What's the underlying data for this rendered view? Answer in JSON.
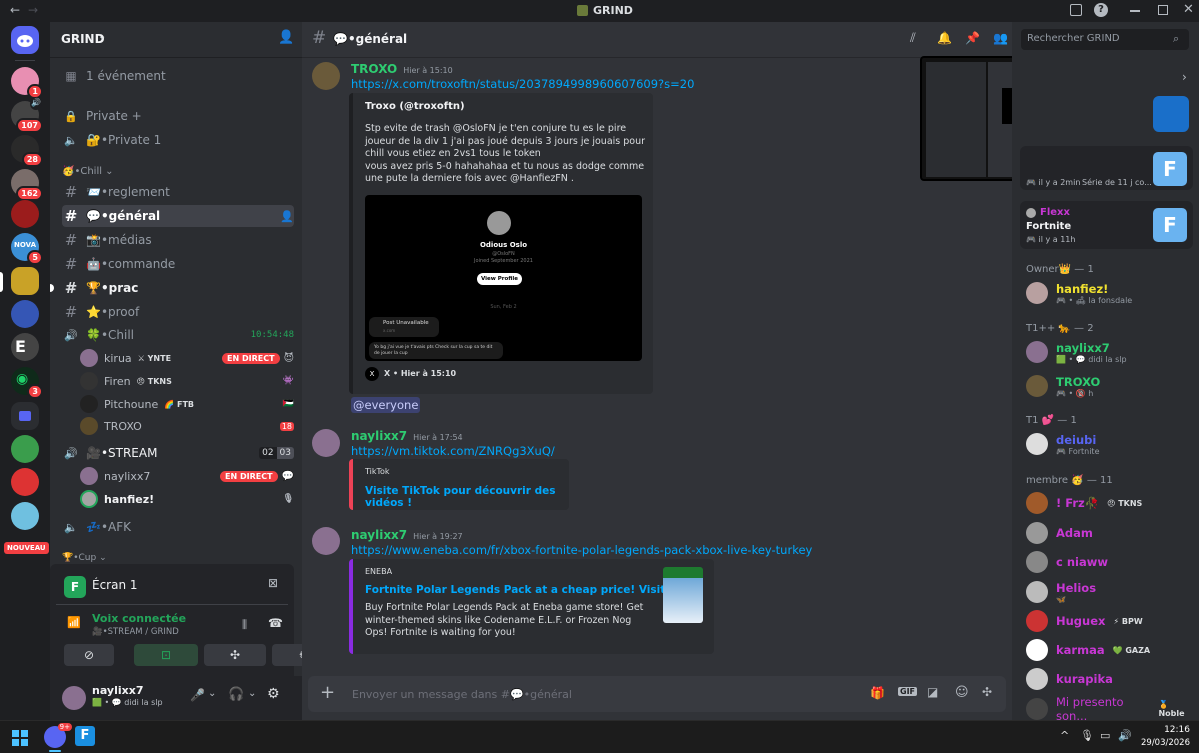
{
  "window": {
    "title": "GRIND"
  },
  "server": {
    "name": "GRIND",
    "event": "1 événement"
  },
  "channels": {
    "private_plus": "Private +",
    "private_1": "🔐•Private 1",
    "cat_chill": "🥳•Chill ⌄",
    "reglement": "📨•reglement",
    "general": "💬•général",
    "medias": "📸•médias",
    "commande": "🤖•commande",
    "prac": "🏆•prac",
    "proof": "⭐•proof",
    "voice_chill": "🍀•Chill",
    "voice_chill_time": "10:54:48",
    "voice_users": [
      {
        "name": "kirua",
        "tag": "⚔ YNTE",
        "live": "EN DIRECT"
      },
      {
        "name": "Firen",
        "tag": "😠 TKNS"
      },
      {
        "name": "Pitchoune",
        "tag": "🌈 FTB"
      },
      {
        "name": "TROXO"
      }
    ],
    "stream": "🎥•STREAM",
    "stream_count_a": "02",
    "stream_count_b": "03",
    "stream_users": [
      {
        "name": "naylixx7",
        "live": "EN DIRECT"
      },
      {
        "name": "hanfiez!"
      }
    ],
    "afk": "💤•AFK",
    "cat_cup": "🏆•Cup ⌄",
    "new_badge": "NOUVEAU"
  },
  "screen": {
    "title": "Écran 1"
  },
  "voice_panel": {
    "status": "Voix connectée",
    "location": "🎥•STREAM / GRIND"
  },
  "user_panel": {
    "name": "naylixx7",
    "status": "🟩 • 💬 didi la slp"
  },
  "header": {
    "channel": "💬•général",
    "search_placeholder": "Rechercher GRIND"
  },
  "messages": [
    {
      "author": "TROXO",
      "time": "Hier à 15:10",
      "link": "https://x.com/troxoftn/status/2037894998960607609?s=20",
      "embed": {
        "author": "Troxo (@troxoftn)",
        "text": "Stp evite de trash @OsloFN je t'en conjure tu es le pire joueur de la div 1 j'ai pas joué depuis 3 jours je jouais pour chill vous etiez en 2vs1 tous le token\nvous avez pris 5-0 hahahahaa et tu nous as dodge comme une pute la derniere fois avec @HanfiezFN .",
        "image": {
          "name": "Odious Oslo",
          "handle": "@OsloFN",
          "joined": "Joined September 2021",
          "button": "View Profile",
          "date": "Sun, Feb 2",
          "unavail": "Post Unavailable",
          "unavail_sub": "x.com",
          "reply": "Yo bg j'ai vue je t'avais pts Check sur la cup sa te dit de jouer la cup"
        },
        "footer": "X • Hier à 15:10"
      },
      "mention": "@everyone"
    },
    {
      "author": "naylixx7",
      "time": "Hier à 17:54",
      "link": "https://vm.tiktok.com/ZNRQg3XuQ/",
      "embed": {
        "provider": "TikTok",
        "title": "Visite TikTok pour découvrir des vidéos !"
      }
    },
    {
      "author": "naylixx7",
      "time": "Hier à 19:27",
      "link": "https://www.eneba.com/fr/xbox-fortnite-polar-legends-pack-xbox-live-key-turkey",
      "embed": {
        "provider": "ENEBA",
        "title": "Fortnite Polar Legends Pack at a cheap price! Visit!",
        "text": "Buy Fortnite Polar Legends Pack at Eneba game store! Get winter-themed skins like Codename E.L.F. or Frozen Nog Ops! Fortnite is waiting for you!"
      }
    }
  ],
  "composer": {
    "placeholder": "Envoyer un message dans #💬•général"
  },
  "members": {
    "activity_top": {
      "time": "🎮 il y a 2min",
      "text": "Série de 11 j co..."
    },
    "activity": {
      "name": "Flexx",
      "game": "Fortnite",
      "time": "🎮 il y a 11h"
    },
    "groups": [
      {
        "label": "Owner👑 — 1",
        "users": [
          {
            "name": "hanfiez!",
            "sub": "🎮 • 🛋 la fonsdale",
            "color": "#f0e130"
          }
        ]
      },
      {
        "label": "T1++ 🐆 — 2",
        "users": [
          {
            "name": "naylixx7",
            "sub": "🟩 • 💬 didi la slp",
            "color": "#2ecc71"
          },
          {
            "name": "TROXO",
            "sub": "🎮 • 🔞 h",
            "color": "#2ecc71"
          }
        ]
      },
      {
        "label": "T1 💕 — 1",
        "users": [
          {
            "name": "deiubi",
            "sub": "🎮 Fortnite",
            "color": "#5865f2"
          }
        ]
      },
      {
        "label": "membre 🥳 — 11",
        "users": [
          {
            "name": "! Frz🥀",
            "tag": "😠 TKNS",
            "color": "#c837d4"
          },
          {
            "name": "Adam",
            "color": "#c837d4"
          },
          {
            "name": "c niaww",
            "color": "#c837d4"
          },
          {
            "name": "Helios",
            "sub": "🦋",
            "color": "#c837d4"
          },
          {
            "name": "Huguex",
            "tag": "⚡ BPW",
            "color": "#c837d4"
          },
          {
            "name": "karmaa",
            "tag": "💚 GAZA",
            "color": "#c837d4"
          },
          {
            "name": "kurapika",
            "color": "#c837d4"
          },
          {
            "name": "Mi presento son...",
            "tag": "🏅 Noble",
            "color": "#c837d4"
          }
        ]
      }
    ]
  },
  "server_badges": [
    "1",
    "107",
    "28",
    "162",
    "",
    "",
    "5",
    "",
    "",
    "",
    "",
    "3"
  ],
  "taskbar": {
    "time": "12:16",
    "date": "29/03/2026",
    "discord_badge": "9+"
  },
  "colors": {
    "accent": "#5865f2",
    "link": "#00a8fc",
    "live": "#f23f42",
    "green": "#23a55a"
  }
}
